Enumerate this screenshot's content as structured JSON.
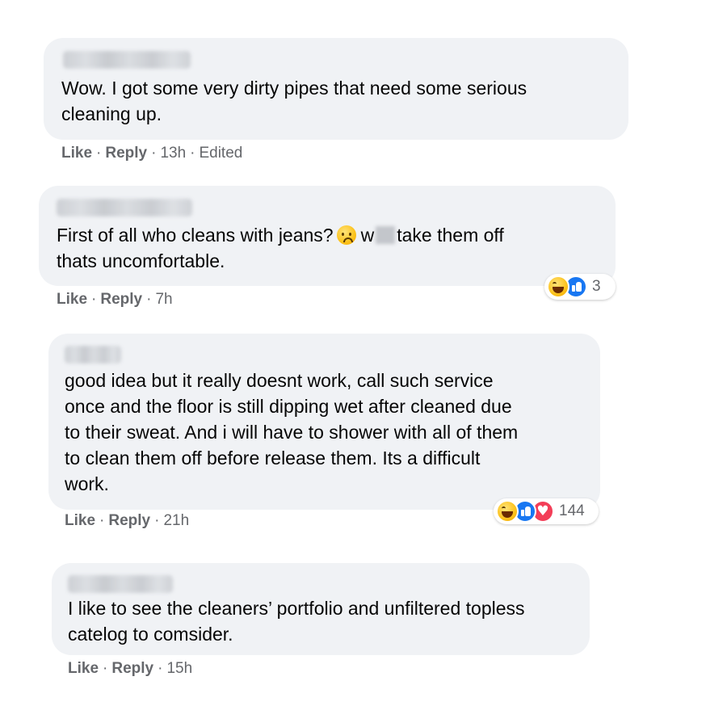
{
  "comments": [
    {
      "text": "Wow. I got some very dirty pipes that need some serious\ncleaning up.",
      "like_label": "Like",
      "reply_label": "Reply",
      "time": "13h",
      "edited": "Edited"
    },
    {
      "text_part1": "First of all who cleans with jeans?",
      "text_part2": "w",
      "text_part3": "take them off",
      "text_line2": "thats uncomfortable.",
      "like_label": "Like",
      "reply_label": "Reply",
      "time": "7h",
      "reactions": [
        "haha-icon",
        "like-icon"
      ],
      "reaction_count": "3"
    },
    {
      "text": "good idea but it really doesnt work, call such service\nonce and the floor is still dipping wet after cleaned due\nto their sweat. And i will have to shower with all of them\nto clean them off before release them. Its a difficult\nwork.",
      "like_label": "Like",
      "reply_label": "Reply",
      "time": "21h",
      "reactions": [
        "haha-icon",
        "like-icon",
        "love-icon"
      ],
      "reaction_count": "144"
    },
    {
      "text": "I like to see the cleaners’ portfolio and unfiltered topless\ncatelog to comsider.",
      "like_label": "Like",
      "reply_label": "Reply",
      "time": "15h"
    }
  ],
  "separator": "·",
  "colors": {
    "bubble": "#f0f2f5",
    "text": "#050505",
    "meta": "#65676b",
    "like_blue": "#1877f2",
    "love_red": "#f33e58",
    "haha_yellow": "#fcc21b"
  }
}
